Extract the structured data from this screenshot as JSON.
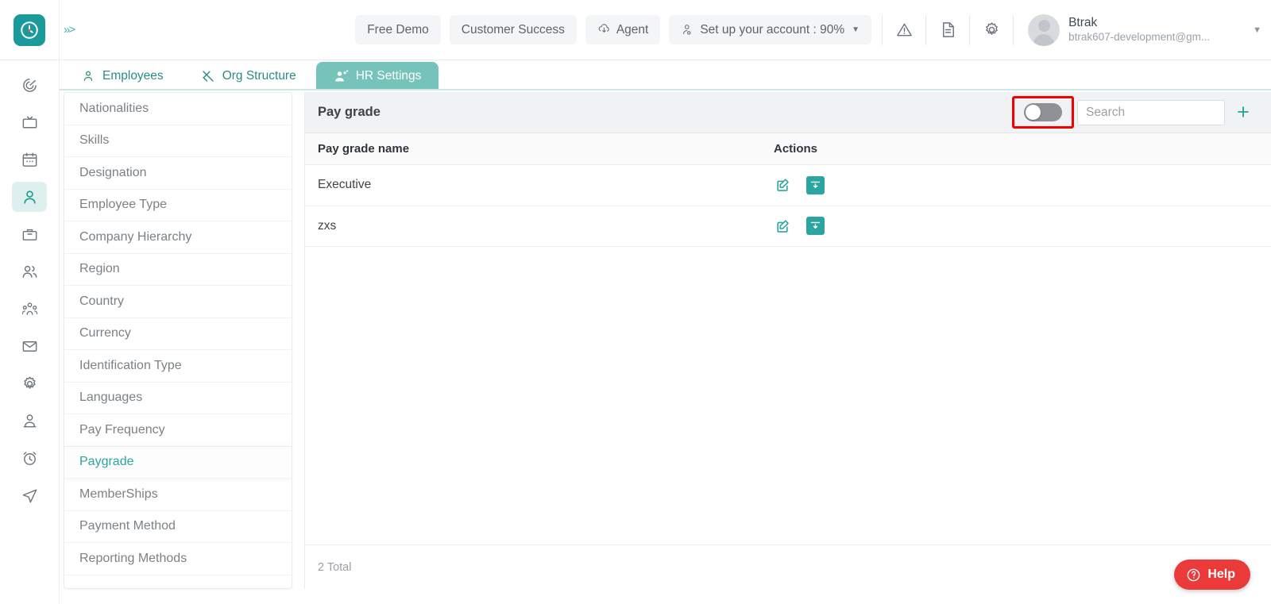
{
  "app": {
    "logo_icon": "clock-logo-icon",
    "expand_icon": "chevron-double-right-icon",
    "accent_color": "#2ba5a0",
    "tab_active_color": "#76c3bb",
    "highlight_color": "#f50000"
  },
  "topbar": {
    "pills": [
      {
        "label": "Free Demo",
        "icon": ""
      },
      {
        "label": "Customer Success",
        "icon": ""
      },
      {
        "label": "Agent",
        "icon": "agent-cloud-icon"
      },
      {
        "label": "Set up your account : 90%",
        "icon": "account-setup-icon",
        "caret": "caret-down-icon"
      }
    ],
    "icons": [
      {
        "name": "warning-icon"
      },
      {
        "name": "document-icon"
      },
      {
        "name": "gear-icon"
      }
    ],
    "user": {
      "name": "Btrak",
      "email": "btrak607-development@gm...",
      "avatar": "user-avatar",
      "caret": "caret-down-icon"
    }
  },
  "rail": {
    "items": [
      {
        "name": "dashboard-spiral-icon",
        "active": false
      },
      {
        "name": "tv-screen-icon",
        "active": false
      },
      {
        "name": "calendar-icon",
        "active": false
      },
      {
        "name": "person-icon",
        "active": true
      },
      {
        "name": "briefcase-icon",
        "active": false
      },
      {
        "name": "people-icon",
        "active": false
      },
      {
        "name": "team-group-icon",
        "active": false
      },
      {
        "name": "mail-envelope-icon",
        "active": false
      },
      {
        "name": "settings-gear-icon",
        "active": false
      },
      {
        "name": "user-profile-icon",
        "active": false
      },
      {
        "name": "alarm-clock-icon",
        "active": false
      },
      {
        "name": "send-paperplane-icon",
        "active": false
      }
    ]
  },
  "tabs": [
    {
      "label": "Employees",
      "icon": "employee-person-icon",
      "active": false
    },
    {
      "label": "Org Structure",
      "icon": "tools-icon",
      "active": false
    },
    {
      "label": "HR Settings",
      "icon": "hr-people-icon",
      "active": true
    }
  ],
  "settings_list": {
    "items": [
      {
        "label": "Nationalities",
        "active": false
      },
      {
        "label": "Skills",
        "active": false
      },
      {
        "label": "Designation",
        "active": false
      },
      {
        "label": "Employee Type",
        "active": false
      },
      {
        "label": "Company Hierarchy",
        "active": false
      },
      {
        "label": "Region",
        "active": false
      },
      {
        "label": "Country",
        "active": false
      },
      {
        "label": "Currency",
        "active": false
      },
      {
        "label": "Identification Type",
        "active": false
      },
      {
        "label": "Languages",
        "active": false
      },
      {
        "label": "Pay Frequency",
        "active": false
      },
      {
        "label": "Paygrade",
        "active": true
      },
      {
        "label": "MemberShips",
        "active": false
      },
      {
        "label": "Payment Method",
        "active": false
      },
      {
        "label": "Reporting Methods",
        "active": false
      }
    ]
  },
  "panel": {
    "title": "Pay grade",
    "toggle": {
      "name": "show-archived-toggle",
      "state": "off"
    },
    "search": {
      "value": "",
      "placeholder": "Search"
    },
    "add_button": {
      "icon": "plus-icon",
      "label": "+"
    },
    "table": {
      "columns": [
        "Pay grade name",
        "Actions"
      ],
      "rows": [
        {
          "name": "Executive",
          "actions": [
            "edit-icon",
            "archive-icon"
          ]
        },
        {
          "name": "zxs",
          "actions": [
            "edit-icon",
            "archive-icon"
          ]
        }
      ]
    },
    "footer": {
      "total_text": "2 Total"
    }
  },
  "help": {
    "label": "Help",
    "icon": "question-circle-icon"
  }
}
